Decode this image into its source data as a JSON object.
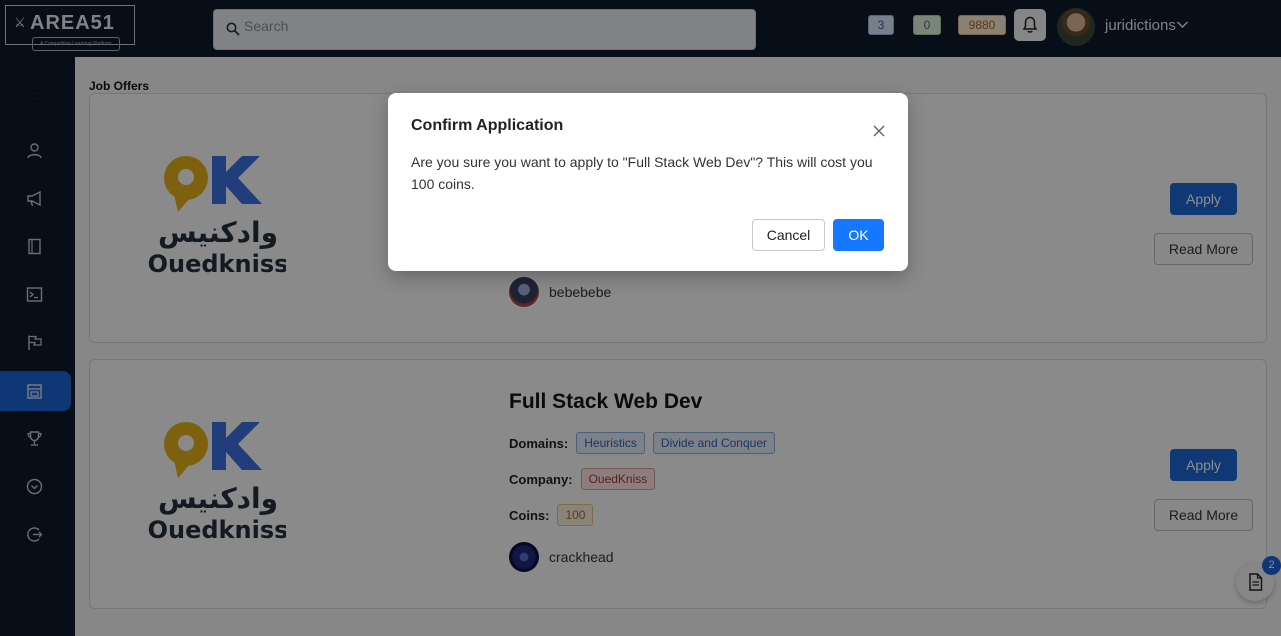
{
  "app": {
    "logo_mark": "⚔",
    "logo_text": "AREA51",
    "logo_tagline": "A Competitive Learning Platform"
  },
  "search": {
    "placeholder": "Search",
    "value": ""
  },
  "header": {
    "badge_blue": "3",
    "badge_green": "0",
    "badge_orange": "9880",
    "username": "juridictions"
  },
  "sidebar": {
    "items": [
      {
        "icon": "menu-icon"
      },
      {
        "icon": "user-icon"
      },
      {
        "icon": "megaphone-icon"
      },
      {
        "icon": "book-icon"
      },
      {
        "icon": "terminal-icon"
      },
      {
        "icon": "flag-icon"
      },
      {
        "icon": "store-icon",
        "active": true
      },
      {
        "icon": "trophy-icon"
      },
      {
        "icon": "chevron-circle-icon"
      },
      {
        "icon": "logout-icon"
      }
    ]
  },
  "main": {
    "section_title": "Job Offers",
    "labels": {
      "domains": "Domains:",
      "company": "Company:",
      "coins": "Coins:"
    },
    "jobs": [
      {
        "poster": "bebebebe",
        "apply_label": "Apply",
        "read_more_label": "Read More"
      },
      {
        "title": "Full Stack Web Dev",
        "domains": [
          "Heuristics",
          "Divide and Conquer"
        ],
        "company": "OuedKniss",
        "coins": "100",
        "poster": "crackhead",
        "apply_label": "Apply",
        "read_more_label": "Read More"
      }
    ],
    "company_logo": {
      "arabic": "وادكنيس",
      "latin": "Ouedkniss"
    }
  },
  "dialog": {
    "title": "Confirm Application",
    "message": "Are you sure you want to apply to \"Full Stack Web Dev\"? This will cost you 100 coins.",
    "cancel_label": "Cancel",
    "ok_label": "OK"
  },
  "fab": {
    "badge": "2"
  },
  "colors": {
    "nav_bg": "#0f1b2b",
    "primary": "#1c63d6",
    "ok_button": "#1677ff",
    "logo_yellow": "#e6b11c",
    "logo_blue": "#3d6fe0"
  }
}
